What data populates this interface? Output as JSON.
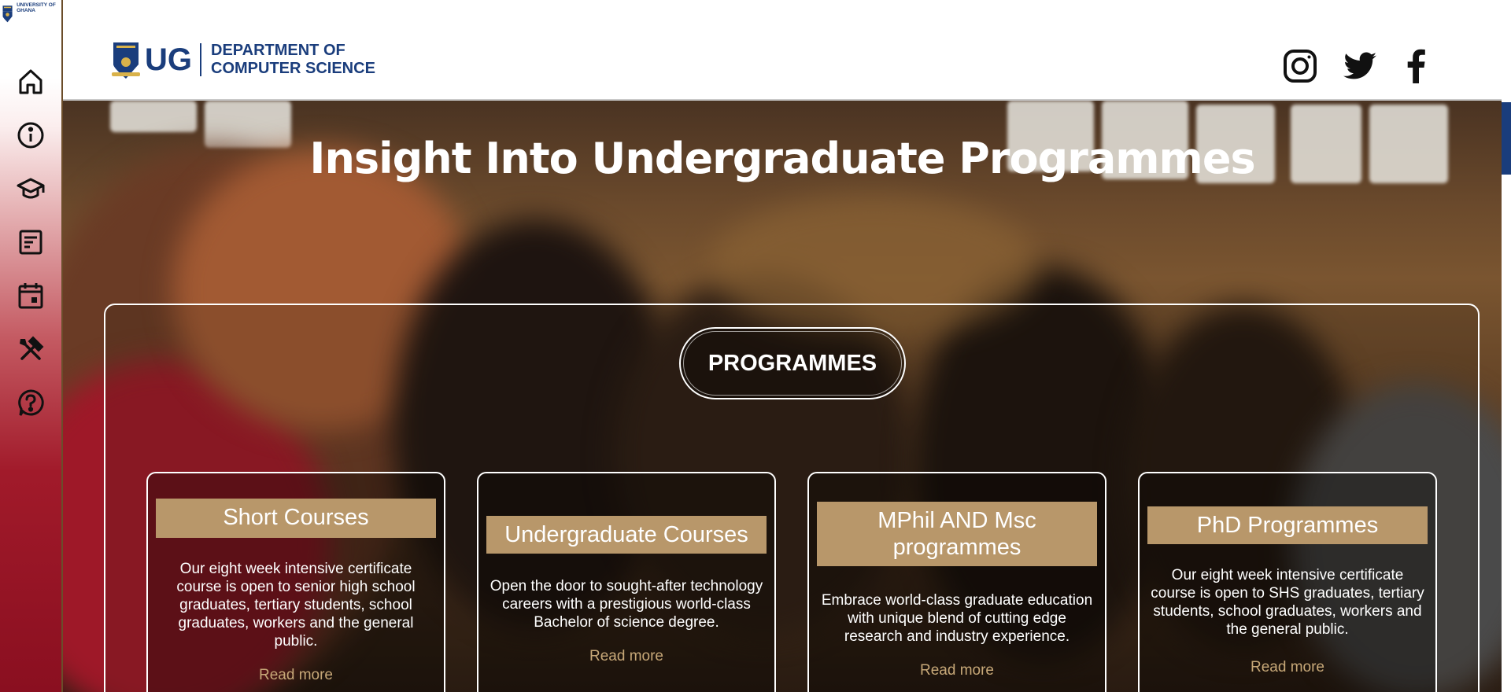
{
  "sidebar": {
    "logo_text": "UNIVERSITY OF GHANA",
    "nav": [
      {
        "name": "home-icon"
      },
      {
        "name": "info-icon"
      },
      {
        "name": "graduation-cap-icon"
      },
      {
        "name": "document-icon"
      },
      {
        "name": "calendar-icon"
      },
      {
        "name": "tools-icon"
      },
      {
        "name": "help-icon"
      }
    ]
  },
  "header": {
    "brand_short": "UG",
    "dept_line1": "DEPARTMENT OF",
    "dept_line2": "COMPUTER SCIENCE",
    "social": [
      "instagram-icon",
      "twitter-icon",
      "facebook-icon"
    ]
  },
  "hero": {
    "title": "Insight Into Undergraduate Programmes",
    "section_label": "PROGRAMMES"
  },
  "cards": [
    {
      "title": "Short Courses",
      "desc": "Our eight week intensive certificate course is open to senior high school graduates, tertiary students, school graduates, workers and the general public.",
      "link": "Read more"
    },
    {
      "title": "Undergraduate Courses",
      "desc": "Open the door to sought-after technology careers with a prestigious world-class Bachelor of science degree.",
      "link": "Read more"
    },
    {
      "title": "MPhil AND Msc programmes",
      "desc": "Embrace world-class graduate education with unique blend of cutting edge research and industry experience.",
      "link": "Read more"
    },
    {
      "title": "PhD Programmes",
      "desc": "Our eight week intensive certificate course is open to SHS graduates, tertiary students, school graduates, workers and the general public.",
      "link": "Read more"
    }
  ],
  "colors": {
    "brand_blue": "#1a3d7c",
    "card_gold": "#b8976a",
    "link_gold": "#c7a878",
    "sidebar_red": "#8a0f20"
  }
}
